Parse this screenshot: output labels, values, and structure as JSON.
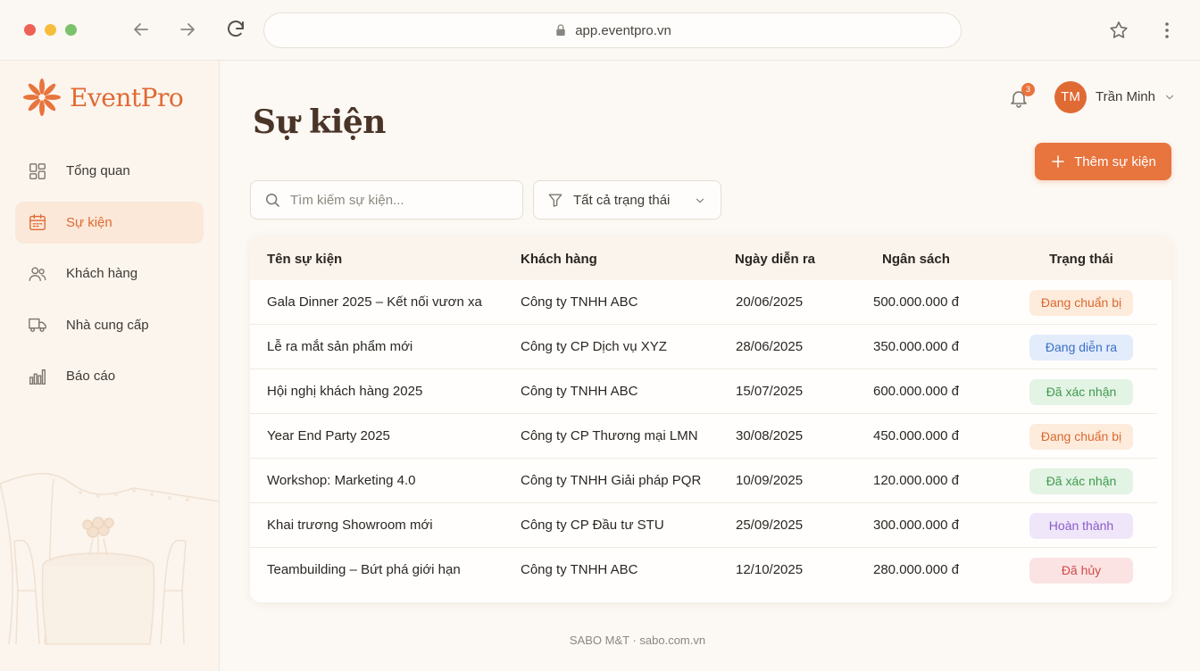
{
  "browser": {
    "url": "app.eventpro.vn"
  },
  "brand": {
    "name": "EventPro",
    "color": "#e06a34"
  },
  "sidebar": {
    "items": [
      {
        "label": "Tổng quan",
        "icon": "grid-icon",
        "active": false
      },
      {
        "label": "Sự kiện",
        "icon": "calendar-icon",
        "active": true
      },
      {
        "label": "Khách hàng",
        "icon": "users-icon",
        "active": false
      },
      {
        "label": "Nhà cung cấp",
        "icon": "truck-icon",
        "active": false
      },
      {
        "label": "Báo cáo",
        "icon": "bar-chart-icon",
        "active": false
      }
    ]
  },
  "header": {
    "title": "Sự kiện",
    "notifications_count": "3",
    "user": {
      "initials": "TM",
      "name": "Trần Minh"
    }
  },
  "toolbar": {
    "add_label": "Thêm sự kiện",
    "search_placeholder": "Tìm kiếm sự kiện...",
    "filter_label": "Tất cả trạng thái"
  },
  "table": {
    "columns": [
      "Tên sự kiện",
      "Khách hàng",
      "Ngày diễn ra",
      "Ngân sách",
      "Trạng thái"
    ],
    "rows": [
      {
        "name": "Gala Dinner 2025 – Kết nối vươn xa",
        "client": "Công ty TNHH ABC",
        "date": "20/06/2025",
        "budget": "500.000.000 đ",
        "status": "Đang chuẩn bị",
        "status_type": "preparing"
      },
      {
        "name": "Lễ ra mắt sản phẩm mới",
        "client": "Công ty CP Dịch vụ XYZ",
        "date": "28/06/2025",
        "budget": "350.000.000 đ",
        "status": "Đang diễn ra",
        "status_type": "ongoing"
      },
      {
        "name": "Hội nghị khách hàng 2025",
        "client": "Công ty TNHH ABC",
        "date": "15/07/2025",
        "budget": "600.000.000 đ",
        "status": "Đã xác nhận",
        "status_type": "confirmed"
      },
      {
        "name": "Year End Party 2025",
        "client": "Công ty CP Thương mại LMN",
        "date": "30/08/2025",
        "budget": "450.000.000 đ",
        "status": "Đang chuẩn bị",
        "status_type": "preparing"
      },
      {
        "name": "Workshop: Marketing 4.0",
        "client": "Công ty TNHH Giải pháp PQR",
        "date": "10/09/2025",
        "budget": "120.000.000 đ",
        "status": "Đã xác nhận",
        "status_type": "confirmed"
      },
      {
        "name": "Khai trương Showroom mới",
        "client": "Công ty CP Đầu tư STU",
        "date": "25/09/2025",
        "budget": "300.000.000 đ",
        "status": "Hoàn thành",
        "status_type": "completed"
      },
      {
        "name": "Teambuilding – Bứt phá giới hạn",
        "client": "Công ty TNHH ABC",
        "date": "12/10/2025",
        "budget": "280.000.000 đ",
        "status": "Đã hủy",
        "status_type": "cancelled"
      }
    ]
  },
  "status_colors": {
    "preparing": {
      "bg": "#fdebdc",
      "fg": "#d9692f"
    },
    "ongoing": {
      "bg": "#e3ecfb",
      "fg": "#3b6fc9"
    },
    "confirmed": {
      "bg": "#e3f3e4",
      "fg": "#3f9a4e"
    },
    "completed": {
      "bg": "#efe6fa",
      "fg": "#8a5cc8"
    },
    "cancelled": {
      "bg": "#fbe3e3",
      "fg": "#cf4a4a"
    }
  },
  "footer": {
    "text": "SABO M&T · sabo.com.vn"
  }
}
